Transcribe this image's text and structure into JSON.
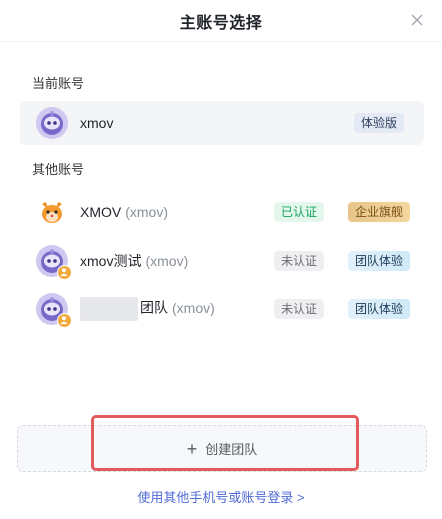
{
  "header": {
    "title": "主账号选择",
    "close_icon": "close-icon"
  },
  "current_section": {
    "label": "当前账号"
  },
  "current_account": {
    "name": "xmov",
    "tag": "体验版",
    "avatar_icon": "robot-avatar-icon"
  },
  "other_section": {
    "label": "其他账号"
  },
  "other_accounts": [
    {
      "name": "XMOV",
      "sub": "(xmov)",
      "verify": "已认证",
      "plan": "企业旗舰",
      "avatar_icon": "fox-mascot-avatar-icon"
    },
    {
      "name": "xmov测试",
      "sub": "(xmov)",
      "verify": "未认证",
      "plan": "团队体验",
      "avatar_icon": "robot-avatar-icon"
    },
    {
      "name": "团队",
      "sub": "(xmov)",
      "verify": "未认证",
      "plan": "团队体验",
      "avatar_icon": "robot-avatar-icon"
    }
  ],
  "create_team": {
    "label": "创建团队",
    "icon": "plus-icon"
  },
  "login_link": {
    "label": "使用其他手机号或账号登录 >"
  },
  "colors": {
    "accent_link": "#4f6bd6",
    "highlight_border": "#e35a5a",
    "verified_green": "#1aa361"
  }
}
